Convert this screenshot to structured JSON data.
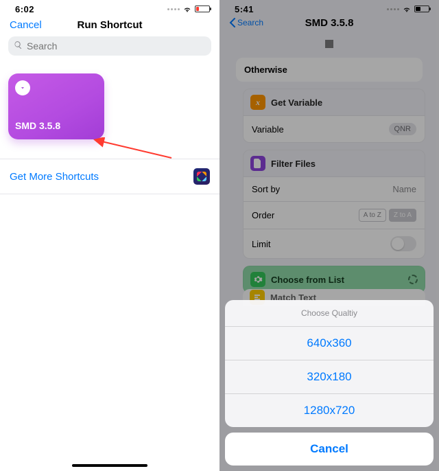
{
  "left": {
    "status": {
      "time": "6:02"
    },
    "nav": {
      "cancel": "Cancel",
      "title": "Run Shortcut"
    },
    "search": {
      "placeholder": "Search"
    },
    "shortcut": {
      "title": "SMD 3.5.8"
    },
    "more_link": "Get More Shortcuts"
  },
  "right": {
    "status": {
      "time": "5:41"
    },
    "nav": {
      "back": "Search",
      "title": "SMD 3.5.8"
    },
    "otherwise": "Otherwise",
    "get_variable": {
      "title": "Get Variable",
      "row_label": "Variable",
      "token": "QNR"
    },
    "filter_files": {
      "title": "Filter Files",
      "sort_by": {
        "label": "Sort by",
        "value": "Name"
      },
      "order": {
        "label": "Order",
        "options": [
          "A to Z",
          "Z to A"
        ],
        "selected": 1
      },
      "limit": {
        "label": "Limit",
        "on": false
      }
    },
    "choose_list": {
      "title": "Choose from List"
    },
    "match_text": {
      "title": "Match Text"
    },
    "sheet": {
      "title": "Choose Qualtiy",
      "options": [
        "640x360",
        "320x180",
        "1280x720"
      ],
      "cancel": "Cancel"
    }
  }
}
